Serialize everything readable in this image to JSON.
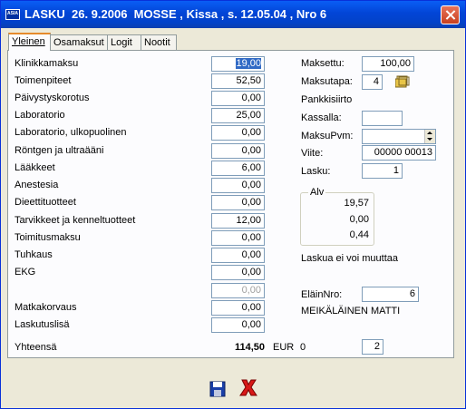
{
  "window": {
    "title": "LASKU  26. 9.2006  MOSSE , Kissa , s. 12.05.04 , Nro 6",
    "app_icon_text": "ASIA"
  },
  "tabs": [
    "Yleinen",
    "Osamaksut",
    "Logit",
    "Nootit"
  ],
  "left_rows": [
    {
      "label": "Klinikkamaksu",
      "value": "19,00"
    },
    {
      "label": "Toimenpiteet",
      "value": "52,50"
    },
    {
      "label": "Päivystyskorotus",
      "value": "0,00"
    },
    {
      "label": "Laboratorio",
      "value": "25,00"
    },
    {
      "label": "Laboratorio, ulkopuolinen",
      "value": "0,00"
    },
    {
      "label": "Röntgen ja ultraääni",
      "value": "0,00"
    },
    {
      "label": "Lääkkeet",
      "value": "6,00"
    },
    {
      "label": "Anestesia",
      "value": "0,00"
    },
    {
      "label": "Dieettituotteet",
      "value": "0,00"
    },
    {
      "label": "Tarvikkeet ja kenneltuotteet",
      "value": "12,00"
    },
    {
      "label": "Toimitusmaksu",
      "value": "0,00"
    },
    {
      "label": "Tuhkaus",
      "value": "0,00"
    },
    {
      "label": "EKG",
      "value": "0,00"
    },
    {
      "label": "",
      "value": "0,00"
    },
    {
      "label": "Matkakorvaus",
      "value": "0,00"
    },
    {
      "label": "Laskutuslisä",
      "value": "0,00"
    }
  ],
  "total": {
    "label": "Yhteensä",
    "amount": "114,50",
    "currency": "EUR",
    "extra": "0",
    "copies": "2"
  },
  "right": {
    "maksettu_label": "Maksettu:",
    "maksettu_value": "100,00",
    "maksutapa_label": "Maksutapa:",
    "maksutapa_value": "4",
    "maksutapa_name": "Pankkisiirto",
    "kassalla_label": "Kassalla:",
    "kassalla_value": "",
    "maksupvm_label": "MaksuPvm:",
    "maksupvm_value": "",
    "viite_label": "Viite:",
    "viite_value": "00000 00013",
    "lasku_label": "Lasku:",
    "lasku_value": "1",
    "alv_label": "Alv",
    "alv_values": [
      "19,57",
      "0,00",
      "0,44"
    ],
    "status_text": "Laskua ei voi muuttaa",
    "elainnro_label": "EläinNro:",
    "elainnro_value": "6",
    "owner_name": "MEIKÄLÄINEN MATTI"
  },
  "icons": {
    "save": "floppy-disk-icon",
    "cancel": "red-x-icon",
    "folder": "folder-icon"
  }
}
